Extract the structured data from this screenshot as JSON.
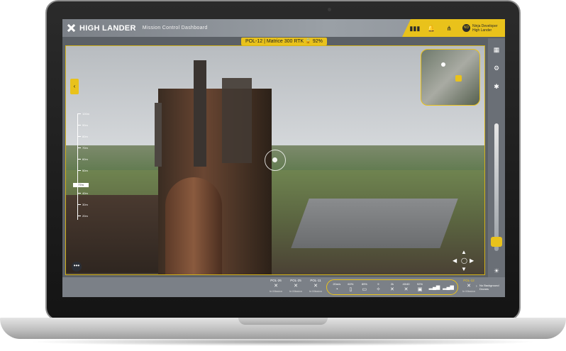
{
  "app": {
    "brand": "HIGH LANDER",
    "subtitle": "Mission Control Dashboard"
  },
  "header": {
    "icons": [
      "signal-icon",
      "notifications-icon",
      "share-icon"
    ],
    "user": {
      "initials": "ND",
      "name": "Ninja Developer",
      "org": "High Lander"
    }
  },
  "video": {
    "drone_label": "POL-12 | Matrice 300 RTK 🔒 92%",
    "altitude_scale": [
      "100m",
      "90m",
      "80m",
      "70m",
      "60m",
      "50m",
      "40m",
      "30m",
      "20m"
    ],
    "current_altitude": "77m"
  },
  "bottom": {
    "drones": [
      {
        "name": "POL-26",
        "status": "In Mission"
      },
      {
        "name": "POL-25",
        "status": "In Mission"
      },
      {
        "name": "POL-11",
        "status": "In Mission"
      }
    ],
    "stats": [
      {
        "value": "20m/s",
        "icon": "speed-icon"
      },
      {
        "value": "60%",
        "icon": "battery-icon"
      },
      {
        "value": "89%",
        "icon": "storage-icon"
      },
      {
        "value": "9",
        "icon": "satellite-icon"
      },
      {
        "value": "2k",
        "icon": "distance-icon"
      },
      {
        "value": "40/40",
        "icon": "rotors-icon"
      },
      {
        "value": "92%",
        "icon": "rc-icon"
      },
      {
        "value": "",
        "icon": "signal-icon"
      },
      {
        "value": "",
        "icon": "link-icon"
      }
    ],
    "active_drone": {
      "name": "POL-12",
      "status": "In Mission"
    },
    "no_background": "No Background Drones"
  },
  "colors": {
    "accent": "#e9c21b",
    "bar": "#7b8087"
  }
}
